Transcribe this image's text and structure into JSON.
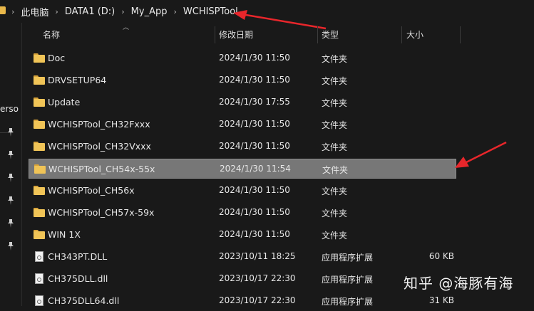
{
  "breadcrumb": [
    "此电脑",
    "DATA1 (D:)",
    "My_App",
    "WCHISPTool"
  ],
  "breadcrumb_sep": "›",
  "nav": {
    "partial_label": "erso",
    "pin_count": 6
  },
  "columns": {
    "name": "名称",
    "date": "修改日期",
    "type": "类型",
    "size": "大小"
  },
  "files": [
    {
      "name": "Doc",
      "date": "2024/1/30 11:50",
      "type": "文件夹",
      "size": "",
      "icon": "folder-icon",
      "selected": false
    },
    {
      "name": "DRVSETUP64",
      "date": "2024/1/30 11:50",
      "type": "文件夹",
      "size": "",
      "icon": "folder-icon",
      "selected": false
    },
    {
      "name": "Update",
      "date": "2024/1/30 17:55",
      "type": "文件夹",
      "size": "",
      "icon": "folder-icon",
      "selected": false
    },
    {
      "name": "WCHISPTool_CH32Fxxx",
      "date": "2024/1/30 11:50",
      "type": "文件夹",
      "size": "",
      "icon": "folder-icon",
      "selected": false
    },
    {
      "name": "WCHISPTool_CH32Vxxx",
      "date": "2024/1/30 11:50",
      "type": "文件夹",
      "size": "",
      "icon": "folder-icon",
      "selected": false
    },
    {
      "name": "WCHISPTool_CH54x-55x",
      "date": "2024/1/30 11:54",
      "type": "文件夹",
      "size": "",
      "icon": "folder-icon",
      "selected": true
    },
    {
      "name": "WCHISPTool_CH56x",
      "date": "2024/1/30 11:50",
      "type": "文件夹",
      "size": "",
      "icon": "folder-icon",
      "selected": false
    },
    {
      "name": "WCHISPTool_CH57x-59x",
      "date": "2024/1/30 11:50",
      "type": "文件夹",
      "size": "",
      "icon": "folder-icon",
      "selected": false
    },
    {
      "name": "WIN 1X",
      "date": "2024/1/30 11:50",
      "type": "文件夹",
      "size": "",
      "icon": "folder-icon",
      "selected": false
    },
    {
      "name": "CH343PT.DLL",
      "date": "2023/10/11 18:25",
      "type": "应用程序扩展",
      "size": "60 KB",
      "icon": "dll-file-icon",
      "selected": false
    },
    {
      "name": "CH375DLL.dll",
      "date": "2023/10/17 22:30",
      "type": "应用程序扩展",
      "size": "",
      "icon": "dll-file-icon",
      "selected": false
    },
    {
      "name": "CH375DLL64.dll",
      "date": "2023/10/17 22:30",
      "type": "应用程序扩展",
      "size": "31 KB",
      "icon": "dll-file-icon",
      "selected": false
    }
  ],
  "watermark": "知乎 @海豚有海",
  "colors": {
    "background": "#191919",
    "selected_row": "#777777",
    "folder": "#f0c457",
    "annotation_arrow": "#e8262b"
  }
}
